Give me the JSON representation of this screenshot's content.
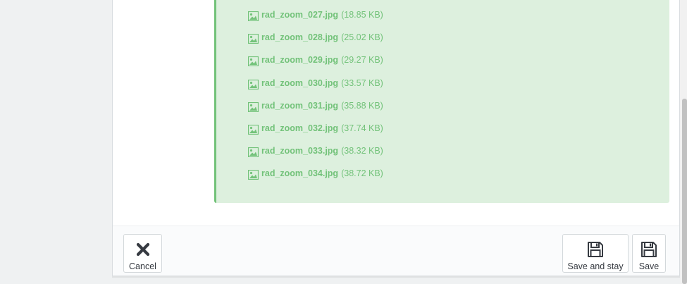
{
  "files": [
    {
      "name": "rad_zoom_027.jpg",
      "size": "(18.85 KB)"
    },
    {
      "name": "rad_zoom_028.jpg",
      "size": "(25.02 KB)"
    },
    {
      "name": "rad_zoom_029.jpg",
      "size": "(29.27 KB)"
    },
    {
      "name": "rad_zoom_030.jpg",
      "size": "(33.57 KB)"
    },
    {
      "name": "rad_zoom_031.jpg",
      "size": "(35.88 KB)"
    },
    {
      "name": "rad_zoom_032.jpg",
      "size": "(37.74 KB)"
    },
    {
      "name": "rad_zoom_033.jpg",
      "size": "(38.32 KB)"
    },
    {
      "name": "rad_zoom_034.jpg",
      "size": "(38.72 KB)"
    }
  ],
  "file_icon": "image-icon",
  "footer": {
    "cancel_label": "Cancel",
    "cancel_icon": "close-icon",
    "save_and_stay_label": "Save and stay",
    "save_and_stay_icon": "floppy-disk-icon",
    "save_label": "Save",
    "save_icon": "floppy-disk-icon"
  },
  "colors": {
    "success_bg": "#ddf0de",
    "success_text": "#72c279",
    "page_bg": "#eff1f2",
    "button_text": "#363a41"
  }
}
